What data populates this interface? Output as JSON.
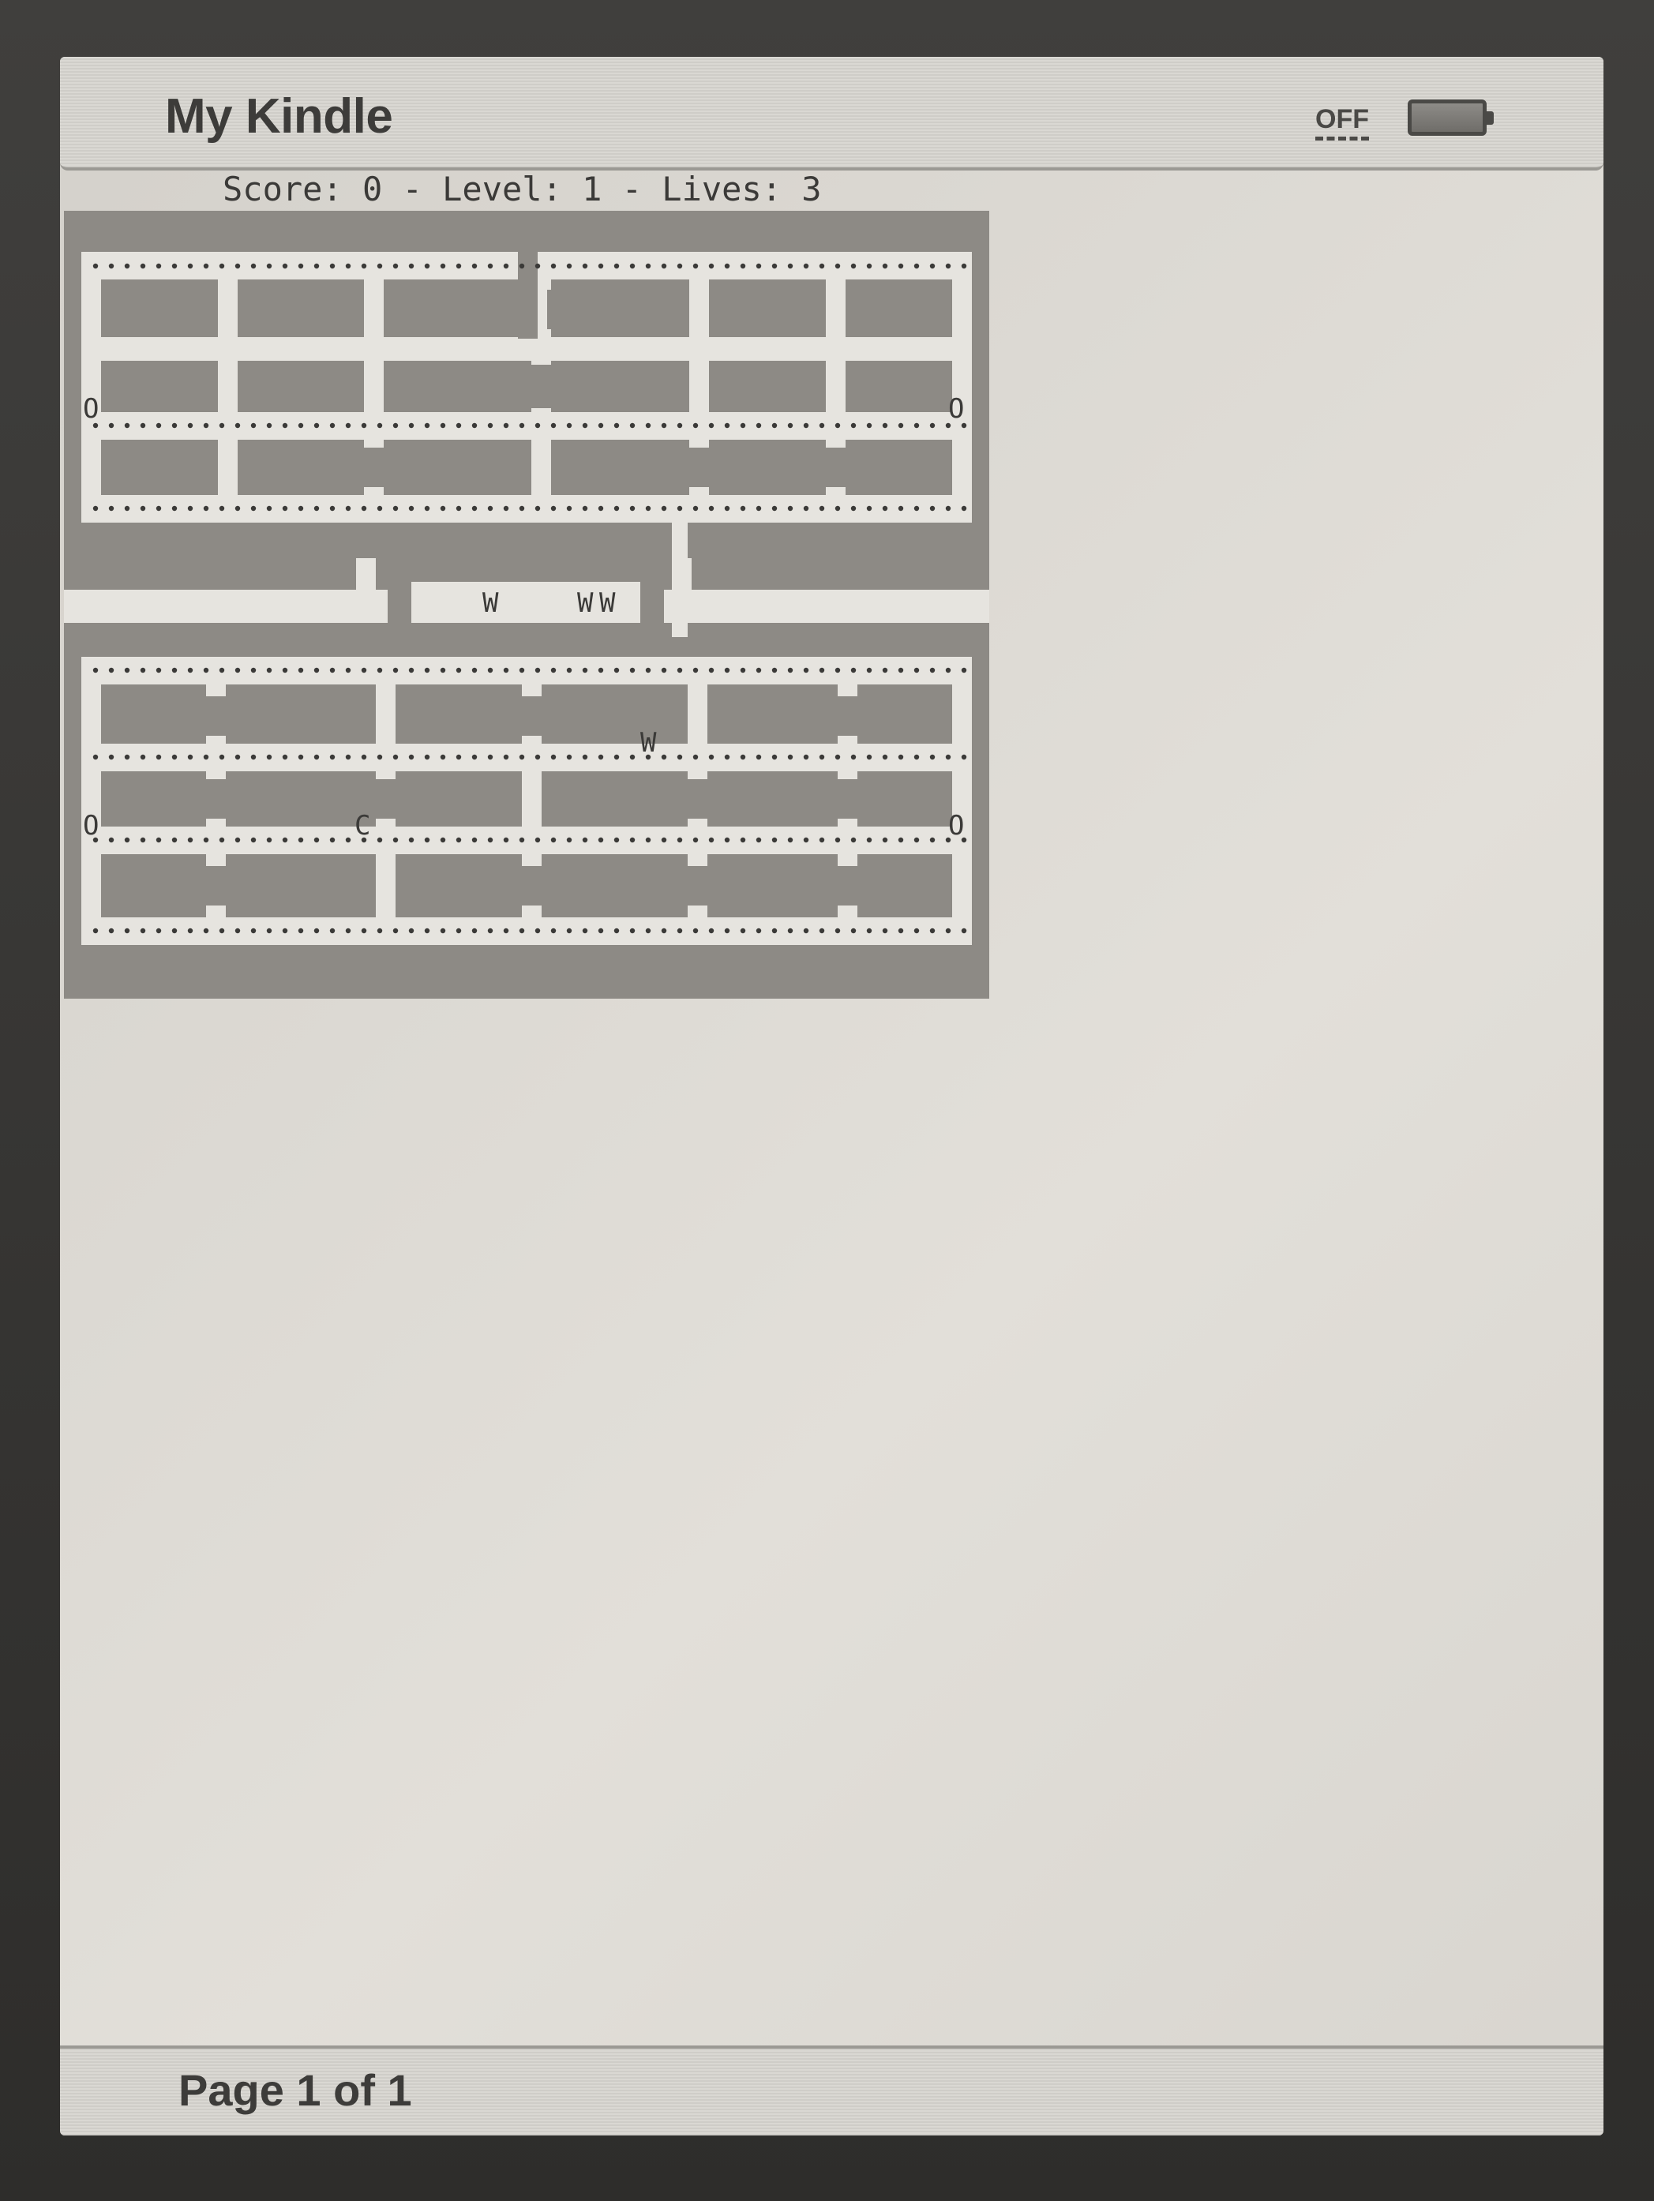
{
  "header": {
    "title": "My Kindle",
    "wifi_label": "OFF",
    "battery_icon": "battery-icon"
  },
  "game": {
    "status": "Score: 0 - Level: 1 - Lives: 3",
    "score": 0,
    "level": 1,
    "lives": 3,
    "power_pellet": "O",
    "ghost": "W",
    "player": "C"
  },
  "footer": {
    "page_indicator": "Page 1 of 1"
  },
  "colors": {
    "wall": "#8d8a85",
    "floor": "#e6e4df",
    "dot": "#3b3a38"
  }
}
